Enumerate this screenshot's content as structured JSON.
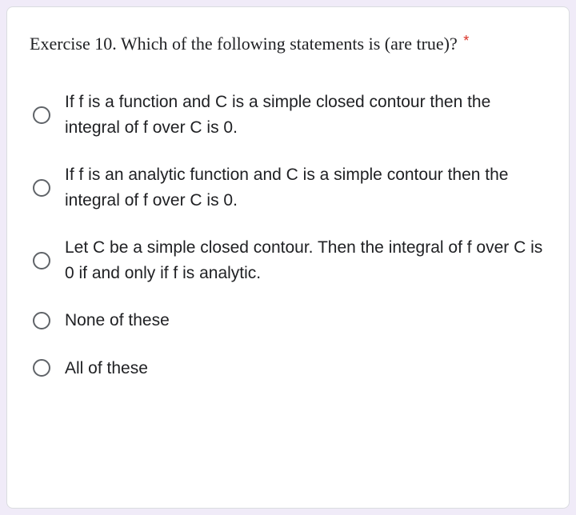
{
  "question": {
    "title": "Exercise 10. Which of the following statements is (are true)?",
    "required_marker": "*"
  },
  "options": [
    {
      "label": "If f is a function and C is a simple closed contour then the integral of f over C is 0."
    },
    {
      "label": "If f is an analytic function and C is a simple contour then the integral of f over C is 0."
    },
    {
      "label": "Let C be a simple closed contour. Then the integral of f over C is 0 if and only if f is analytic."
    },
    {
      "label": "None of these"
    },
    {
      "label": "All of these"
    }
  ]
}
